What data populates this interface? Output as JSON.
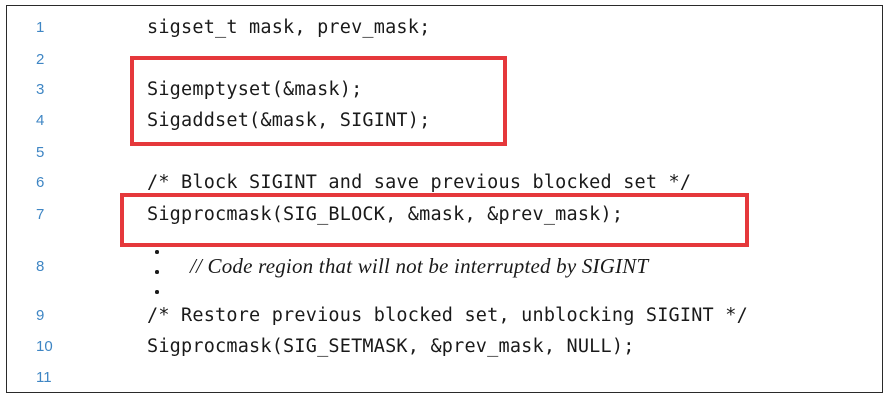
{
  "code_listing": {
    "lines": [
      {
        "number": "1",
        "text": "sigset_t mask, prev_mask;"
      },
      {
        "number": "2",
        "text": ""
      },
      {
        "number": "3",
        "text": "Sigemptyset(&mask);"
      },
      {
        "number": "4",
        "text": "Sigaddset(&mask, SIGINT);"
      },
      {
        "number": "5",
        "text": ""
      },
      {
        "number": "6",
        "text": "/* Block SIGINT and save previous blocked set */"
      },
      {
        "number": "7",
        "text": "Sigprocmask(SIG_BLOCK, &mask, &prev_mask);"
      },
      {
        "number": "8",
        "text": "// Code region that will not be interrupted by SIGINT"
      },
      {
        "number": "9",
        "text": "/* Restore previous blocked set, unblocking SIGINT */"
      },
      {
        "number": "10",
        "text": "Sigprocmask(SIG_SETMASK, &prev_mask, NULL);"
      },
      {
        "number": "11",
        "text": ""
      }
    ]
  },
  "colors": {
    "line_number": "#3f86c4",
    "highlight_border": "#e5383b",
    "frame_border": "#2a2a2a",
    "code_text": "#1a1a1a"
  }
}
